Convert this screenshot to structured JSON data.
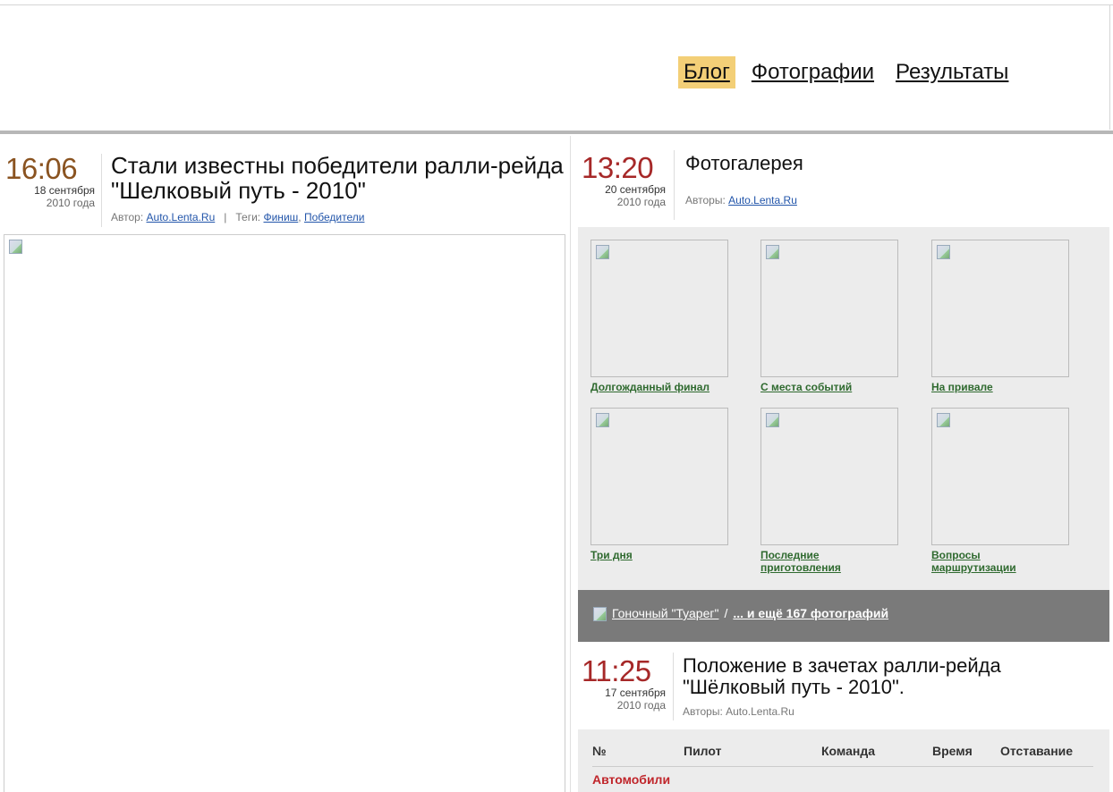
{
  "nav": {
    "items": [
      {
        "label": "Блог",
        "active": true
      },
      {
        "label": "Фотографии",
        "active": false
      },
      {
        "label": "Результаты",
        "active": false
      }
    ]
  },
  "post_left": {
    "time": "16:06",
    "date": "18 сентября",
    "year": "2010 года",
    "title": "Стали известны победители ралли-рейда \"Шелковый путь - 2010\"",
    "author_label": "Автор:",
    "author": "Auto.Lenta.Ru",
    "tags_label": "Теги:",
    "tags": [
      "Финиш",
      "Победители"
    ]
  },
  "gallery_post": {
    "time": "13:20",
    "date": "20 сентября",
    "year": "2010 года",
    "title": "Фотогалерея",
    "authors_label": "Авторы:",
    "author": "Auto.Lenta.Ru",
    "thumbs": [
      {
        "caption": "Долгожданный финал"
      },
      {
        "caption": "С места событий"
      },
      {
        "caption": "На привале"
      },
      {
        "caption": "Три дня"
      },
      {
        "caption": "Последние приготовления"
      },
      {
        "caption": "Вопросы маршрутизации"
      }
    ],
    "bar": {
      "album": "Гоночный \"Туарег\"",
      "separator": "/",
      "more": "... и ещё 167 фотографий"
    }
  },
  "standings_post": {
    "time": "11:25",
    "date": "17 сентября",
    "year": "2010 года",
    "title": "Положение в зачетах ралли-рейда \"Шёлковый путь - 2010\".",
    "authors": "Авторы: Auto.Lenta.Ru",
    "table": {
      "headers": [
        "№",
        "Пилот",
        "Команда",
        "Время",
        "Отставание"
      ],
      "category": "Автомобили"
    }
  },
  "colors": {
    "nav_active_bg": "#f3cf77",
    "time_red": "#a62828",
    "time_brown": "#8a5320",
    "link_green": "#2f6a2f",
    "bar_grey": "#7a7a7a",
    "category_red": "#c0262b"
  }
}
